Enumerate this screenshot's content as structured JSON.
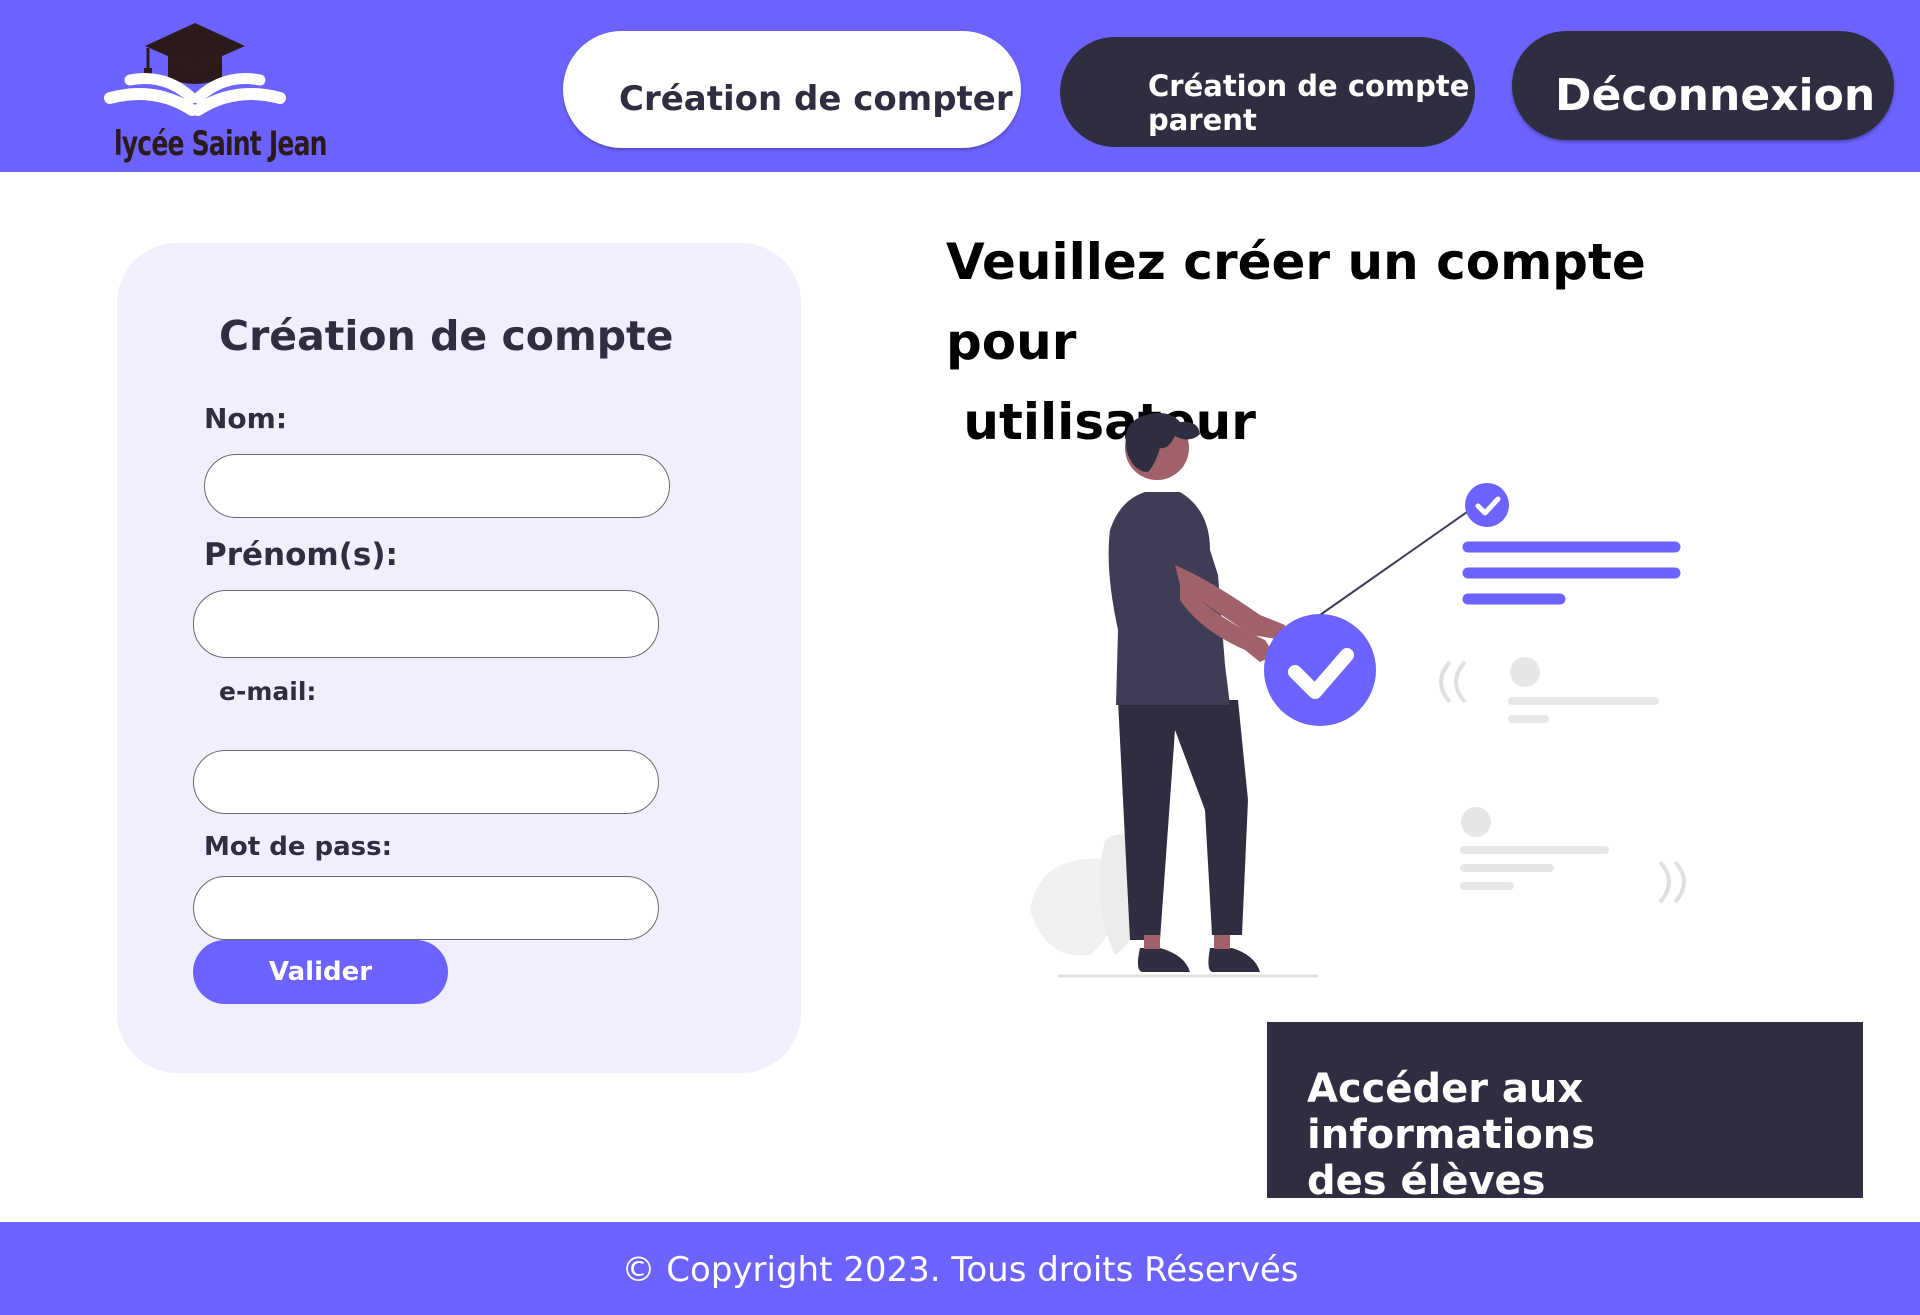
{
  "header": {
    "logo_text": "lycée Saint Jean",
    "nav": [
      {
        "label": "Création de compter"
      },
      {
        "label_line1": "Création de compte",
        "label_line2": "parent"
      },
      {
        "label": "Déconnexion"
      }
    ]
  },
  "form": {
    "title": "Création de compte",
    "fields": [
      {
        "label": "Nom:",
        "value": "",
        "placeholder": ""
      },
      {
        "label": "Prénom(s):",
        "value": "",
        "placeholder": ""
      },
      {
        "label": "e-mail:",
        "value": "",
        "placeholder": ""
      },
      {
        "label": "Mot de pass:",
        "value": "",
        "placeholder": ""
      }
    ],
    "submit_label": "Valider"
  },
  "main": {
    "heading_line1": "Veuillez créer un compte pour",
    "heading_line2": " utilisateur",
    "info_button_line1": "Accéder aux informations",
    "info_button_line2": "des élèves"
  },
  "footer": {
    "copyright": "© Copyright 2023. Tous droits Réservés"
  },
  "colors": {
    "brand": "#6c63ff",
    "dark": "#2f2e41",
    "card_bg": "#efeffd"
  }
}
